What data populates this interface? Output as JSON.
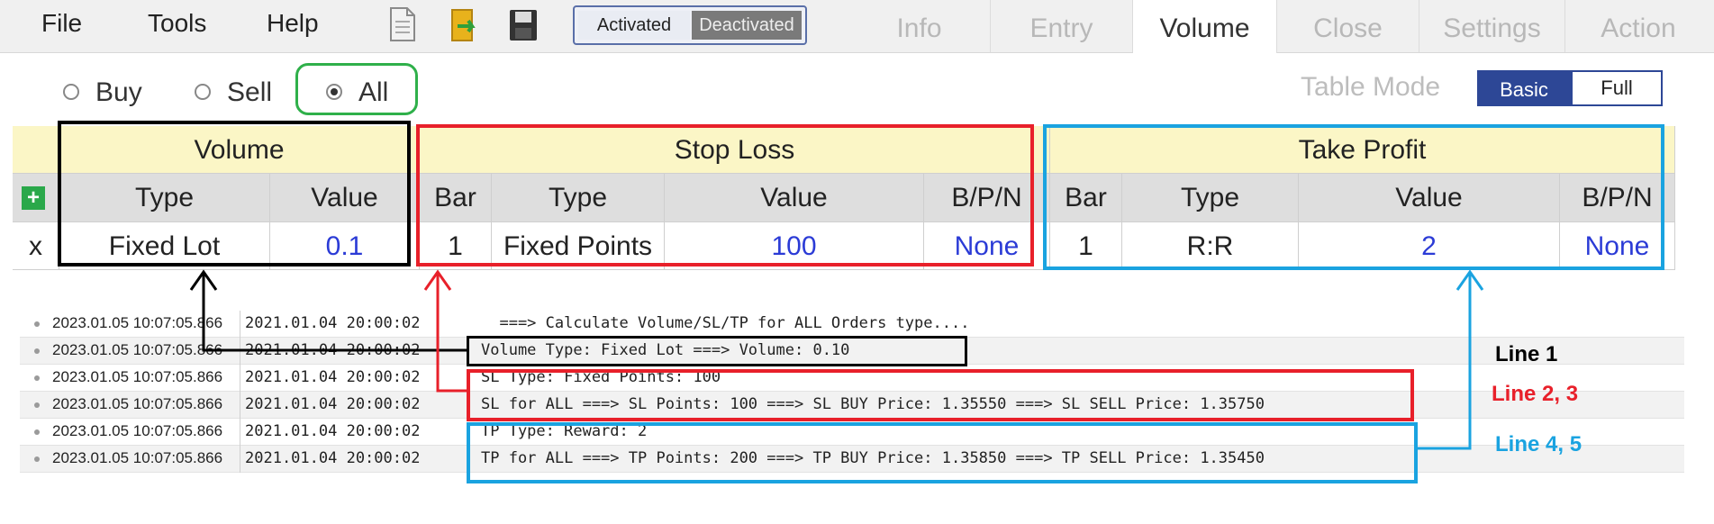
{
  "menu": {
    "file": "File",
    "tools": "Tools",
    "help": "Help"
  },
  "toolbar_icons": [
    "document-icon",
    "folder-icon",
    "save-icon"
  ],
  "status_toggle": {
    "activated": "Activated",
    "deactivated": "Deactivated",
    "selected": "Deactivated"
  },
  "tabs": [
    "Info",
    "Entry",
    "Volume",
    "Close",
    "Settings",
    "Action"
  ],
  "active_tab": "Volume",
  "order_filter": {
    "options": [
      "Buy",
      "Sell",
      "All"
    ],
    "selected": "All"
  },
  "table_mode": {
    "label": "Table Mode",
    "basic": "Basic",
    "full": "Full",
    "selected": "Basic"
  },
  "table": {
    "groups": {
      "volume": "Volume",
      "stop_loss": "Stop Loss",
      "take_profit": "Take Profit"
    },
    "columns": {
      "vol_type": "Type",
      "vol_value": "Value",
      "sl_bar": "Bar",
      "sl_type": "Type",
      "sl_value": "Value",
      "sl_bpn": "B/P/N",
      "tp_bar": "Bar",
      "tp_type": "Type",
      "tp_value": "Value",
      "tp_bpn": "B/P/N"
    },
    "row": {
      "delete": "x",
      "vol_type": "Fixed Lot",
      "vol_value": "0.1",
      "sl_bar": "1",
      "sl_type": "Fixed Points",
      "sl_value": "100",
      "sl_bpn": "None",
      "tp_bar": "1",
      "tp_type": "R:R",
      "tp_value": "2",
      "tp_bpn": "None"
    }
  },
  "log": [
    {
      "ts": "2023.01.05 10:07:05.866",
      "time": "2021.01.04 20:00:02",
      "msg": "  ===> Calculate Volume/SL/TP for ALL Orders type...."
    },
    {
      "ts": "2023.01.05 10:07:05.866",
      "time": "2021.01.04 20:00:02",
      "msg": "Volume Type: Fixed Lot ===> Volume: 0.10"
    },
    {
      "ts": "2023.01.05 10:07:05.866",
      "time": "2021.01.04 20:00:02",
      "msg": "SL Type: Fixed Points: 100"
    },
    {
      "ts": "2023.01.05 10:07:05.866",
      "time": "2021.01.04 20:00:02",
      "msg": "SL for ALL ===> SL Points: 100 ===> SL BUY Price: 1.35550 ===> SL SELL Price: 1.35750"
    },
    {
      "ts": "2023.01.05 10:07:05.866",
      "time": "2021.01.04 20:00:02",
      "msg": "TP Type: Reward: 2"
    },
    {
      "ts": "2023.01.05 10:07:05.866",
      "time": "2021.01.04 20:00:02",
      "msg": "TP for ALL ===> TP Points: 200 ===> TP BUY Price: 1.35850 ===> TP SELL Price: 1.35450"
    }
  ],
  "annotations": {
    "line1": "Line 1",
    "line23": "Line 2, 3",
    "line45": "Line 4, 5"
  },
  "colors": {
    "black_box": "#000000",
    "red_box": "#e8202a",
    "blue_box": "#1aa3e0",
    "green_box": "#2fb04a",
    "header_yellow": "#fbf6c6",
    "header_gray": "#dedede",
    "accent_blue": "#2d4796"
  }
}
